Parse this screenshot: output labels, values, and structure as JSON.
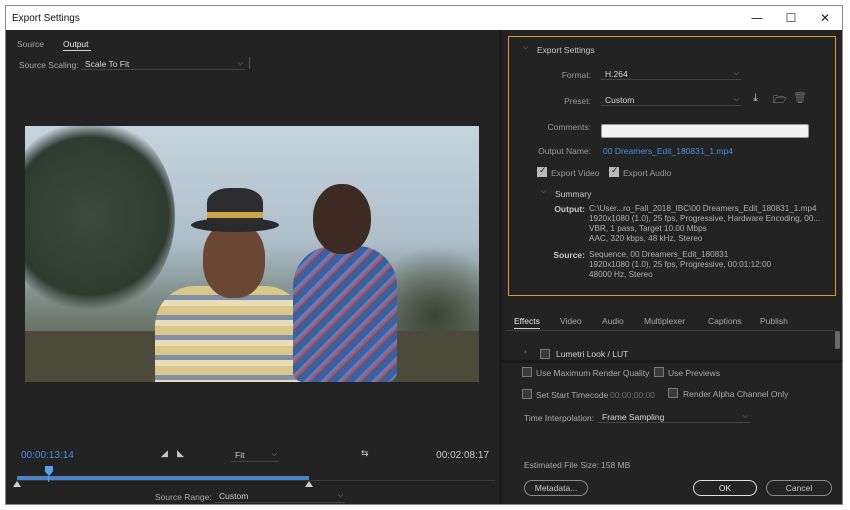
{
  "window": {
    "title": "Export Settings",
    "minimize_glyph": "—",
    "maximize_glyph": "☐",
    "close_glyph": "✕"
  },
  "left": {
    "tabs": [
      {
        "label": "Source"
      },
      {
        "label": "Output",
        "active": true
      }
    ],
    "source_scaling": {
      "label": "Source Scaling:",
      "value": "Scale To Fit"
    },
    "timeline": {
      "current_time": "00:00:13:14",
      "duration": "00:02:08:17",
      "zoom": "Fit",
      "playhead_fraction": 0.105,
      "work_area_fraction": 0.61
    },
    "source_range": {
      "label": "Source Range:",
      "value": "Custom"
    }
  },
  "export_settings": {
    "heading": "Export Settings",
    "format": {
      "label": "Format:",
      "value": "H.264"
    },
    "preset": {
      "label": "Preset:",
      "value": "Custom"
    },
    "comments": {
      "label": "Comments:",
      "value": ""
    },
    "output_name": {
      "label": "Output Name:",
      "value": "00 Dreamers_Edit_180831_1.mp4"
    },
    "export_video": {
      "label": "Export Video",
      "checked": true
    },
    "export_audio": {
      "label": "Export Audio",
      "checked": true
    },
    "summary": {
      "heading": "Summary",
      "output_label": "Output:",
      "output_lines": [
        "C:\\User...ro_Fall_2018_IBC\\00 Dreamers_Edit_180831_1.mp4",
        "1920x1080 (1.0), 25 fps, Progressive, Hardware Encoding, 00...",
        "VBR, 1 pass, Target 10.00 Mbps",
        "AAC, 320 kbps, 48 kHz, Stereo"
      ],
      "source_label": "Source:",
      "source_lines": [
        "Sequence, 00 Dreamers_Edit_180831",
        "1920x1080 (1.0), 25 fps, Progressive, 00:01:12:00",
        "48000 Hz, Stereo"
      ]
    }
  },
  "settings_tabs": [
    {
      "label": "Effects",
      "active": true
    },
    {
      "label": "Video"
    },
    {
      "label": "Audio"
    },
    {
      "label": "Multiplexer"
    },
    {
      "label": "Captions"
    },
    {
      "label": "Publish"
    }
  ],
  "effects": {
    "lumetri_label": "Lumetri Look / LUT"
  },
  "options": {
    "max_render_quality": "Use Maximum Render Quality",
    "use_previews": "Use Previews",
    "set_start_timecode": "Set Start Timecode",
    "start_timecode_value": "00:00:00:00",
    "render_alpha": "Render Alpha Channel Only",
    "time_interpolation_label": "Time Interpolation:",
    "time_interpolation_value": "Frame Sampling",
    "estimated_size_label": "Estimated File Size:",
    "estimated_size_value": "158 MB"
  },
  "buttons": {
    "metadata": "Metadata...",
    "ok": "OK",
    "cancel": "Cancel"
  },
  "colors": {
    "accent_blue": "#4a90e2",
    "highlight_orange": "#e29a2c",
    "panel_bg": "#232323"
  },
  "icons": {
    "save_preset": "download-icon",
    "import_preset": "import-folder-icon",
    "delete_preset": "trash-icon"
  }
}
